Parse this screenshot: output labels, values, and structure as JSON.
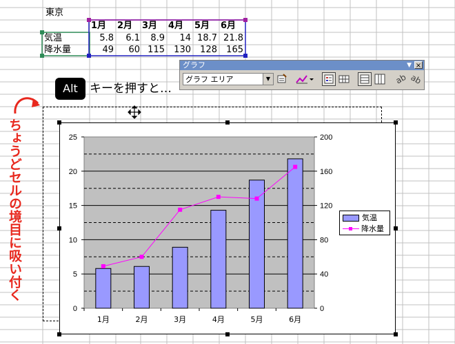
{
  "sheet": {
    "title": "東京",
    "months": [
      "1月",
      "2月",
      "3月",
      "4月",
      "5月",
      "6月"
    ],
    "row_labels": [
      "気温",
      "降水量"
    ],
    "temperature": [
      "5.8",
      "6.1",
      "8.9",
      "14",
      "18.7",
      "21.8"
    ],
    "precipitation": [
      "49",
      "60",
      "115",
      "130",
      "128",
      "165"
    ]
  },
  "toolbar": {
    "title": "グラフ",
    "menu_arrow": "▼",
    "close": "×",
    "select_value": "グラフ エリア"
  },
  "hint": {
    "key": "Alt",
    "text": "キーを押すと…",
    "vertical": "ちょうどセルの境目に吸い付く"
  },
  "chart_data": {
    "type": "bar",
    "categories": [
      "1月",
      "2月",
      "3月",
      "4月",
      "5月",
      "6月"
    ],
    "series": [
      {
        "name": "気温",
        "type": "bar",
        "axis": "left",
        "values": [
          5.8,
          6.1,
          8.9,
          14.3,
          18.7,
          21.8
        ],
        "color": "#9999ff"
      },
      {
        "name": "降水量",
        "type": "line",
        "axis": "right",
        "values": [
          49,
          60,
          115,
          130,
          128,
          165
        ],
        "color": "#ff00ff"
      }
    ],
    "ylim": [
      0,
      25
    ],
    "y_ticks": [
      "0",
      "5",
      "10",
      "15",
      "20",
      "25"
    ],
    "y2lim": [
      0,
      200
    ],
    "y2_ticks": [
      "0",
      "40",
      "80",
      "120",
      "160",
      "200"
    ],
    "plot_background": "#c0c0c0",
    "legend": "right"
  }
}
